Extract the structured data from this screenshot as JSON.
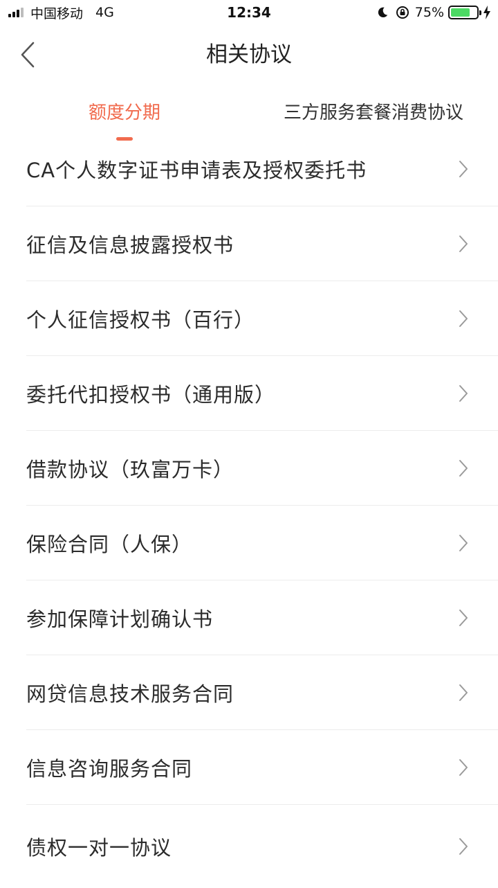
{
  "status_bar": {
    "carrier": "中国移动",
    "network": "4G",
    "time": "12:34",
    "battery_percent": "75%",
    "battery_level": 0.75,
    "battery_color": "#4cd964"
  },
  "nav": {
    "title": "相关协议",
    "back_icon": "chevron-left-icon"
  },
  "tabs": [
    {
      "label": "额度分期",
      "active": true
    },
    {
      "label": "三方服务套餐消费协议",
      "active": false
    }
  ],
  "accent_color": "#f16b4e",
  "agreements": [
    {
      "label": "CA个人数字证书申请表及授权委托书"
    },
    {
      "label": "征信及信息披露授权书"
    },
    {
      "label": "个人征信授权书（百行）"
    },
    {
      "label": "委托代扣授权书（通用版）"
    },
    {
      "label": "借款协议（玖富万卡）"
    },
    {
      "label": "保险合同（人保）"
    },
    {
      "label": "参加保障计划确认书"
    },
    {
      "label": "网贷信息技术服务合同"
    },
    {
      "label": "信息咨询服务合同"
    },
    {
      "label": "债权一对一协议"
    }
  ]
}
